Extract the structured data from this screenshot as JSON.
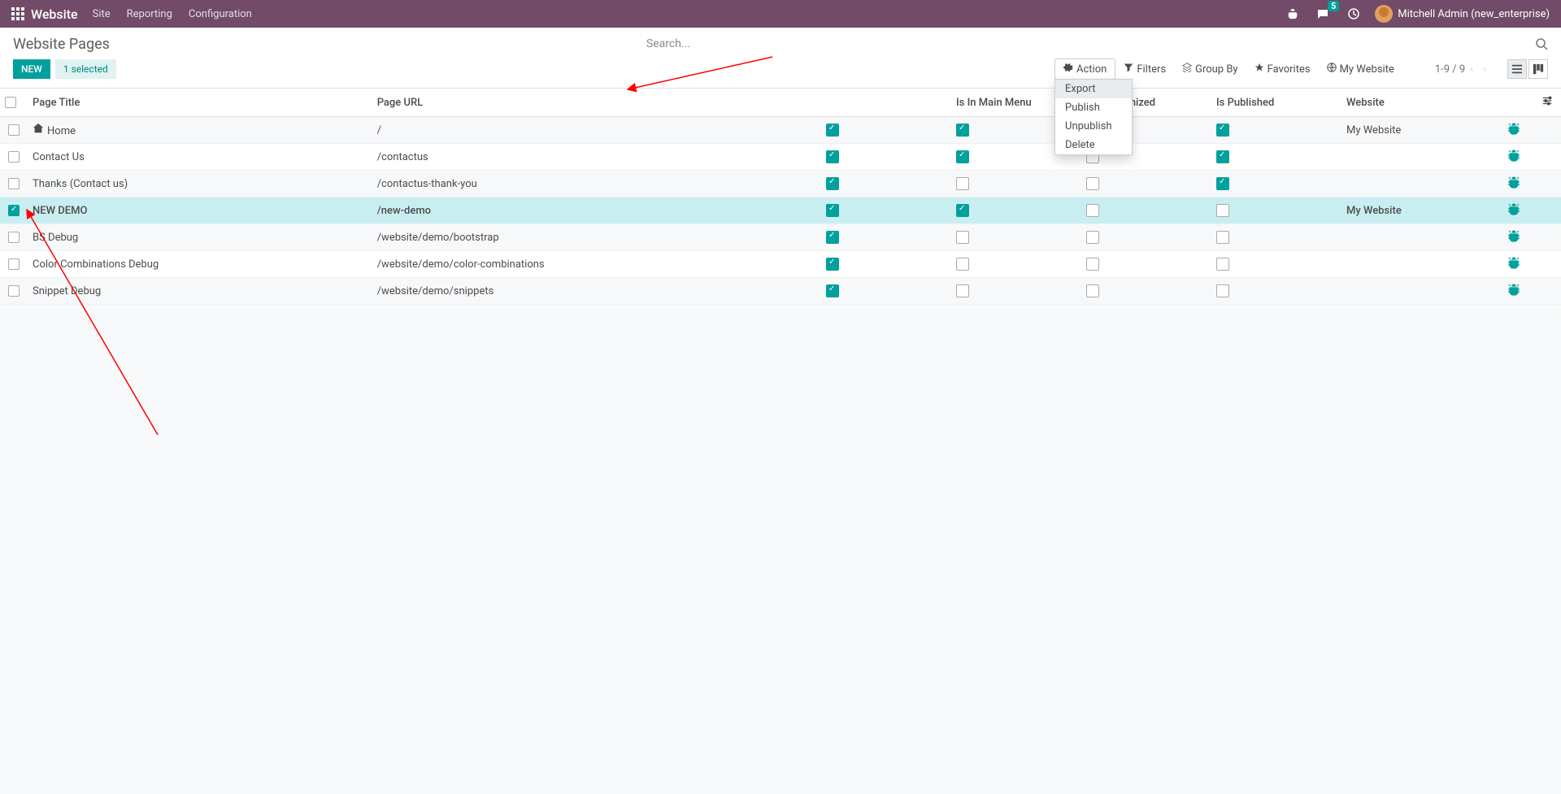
{
  "topnav": {
    "brand": "Website",
    "menus": [
      "Site",
      "Reporting",
      "Configuration"
    ],
    "chat_badge": "5",
    "user_name": "Mitchell Admin (new_enterprise)"
  },
  "cp": {
    "title": "Website Pages",
    "search_placeholder": "Search...",
    "new_btn": "NEW",
    "selected_tag": "1 selected",
    "action_label": "Action",
    "action_items": [
      "Export",
      "Publish",
      "Unpublish",
      "Delete"
    ],
    "filters_label": "Filters",
    "groupby_label": "Group By",
    "favorites_label": "Favorites",
    "mysite_label": "My Website",
    "pager": "1-9 / 9"
  },
  "table": {
    "headers": {
      "title": "Page Title",
      "url": "Page URL",
      "indexed": "",
      "mainmenu": "Is In Main Menu",
      "seo": "SEO optimized",
      "published": "Is Published",
      "website": "Website"
    },
    "rows": [
      {
        "checked": false,
        "home": true,
        "title": "Home",
        "url": "/",
        "indexed": true,
        "mainmenu": true,
        "seo": false,
        "published": true,
        "website": "My Website"
      },
      {
        "checked": false,
        "home": false,
        "title": "Contact Us",
        "url": "/contactus",
        "indexed": true,
        "mainmenu": true,
        "seo": false,
        "published": true,
        "website": ""
      },
      {
        "checked": false,
        "home": false,
        "title": "Thanks (Contact us)",
        "url": "/contactus-thank-you",
        "indexed": true,
        "mainmenu": false,
        "seo": false,
        "published": true,
        "website": ""
      },
      {
        "checked": true,
        "home": false,
        "title": "NEW DEMO",
        "url": "/new-demo",
        "indexed": true,
        "mainmenu": true,
        "seo": false,
        "published": false,
        "website": "My Website"
      },
      {
        "checked": false,
        "home": false,
        "title": "BS Debug",
        "url": "/website/demo/bootstrap",
        "indexed": true,
        "mainmenu": false,
        "seo": false,
        "published": false,
        "website": ""
      },
      {
        "checked": false,
        "home": false,
        "title": "Color Combinations Debug",
        "url": "/website/demo/color-combinations",
        "indexed": true,
        "mainmenu": false,
        "seo": false,
        "published": false,
        "website": ""
      },
      {
        "checked": false,
        "home": false,
        "title": "Snippet Debug",
        "url": "/website/demo/snippets",
        "indexed": true,
        "mainmenu": false,
        "seo": false,
        "published": false,
        "website": ""
      }
    ]
  }
}
